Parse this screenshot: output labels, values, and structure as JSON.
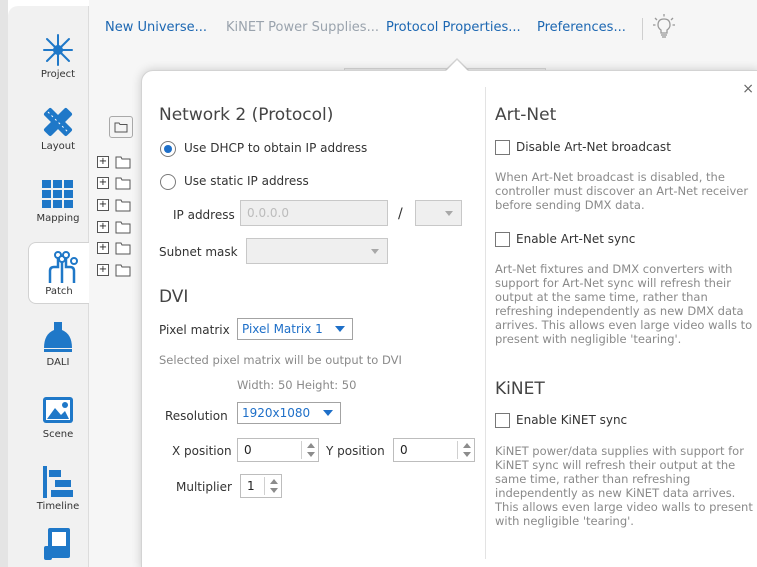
{
  "sidebar": {
    "items": [
      {
        "label": "Project",
        "icon": "project-icon"
      },
      {
        "label": "Layout",
        "icon": "layout-icon"
      },
      {
        "label": "Mapping",
        "icon": "mapping-icon"
      },
      {
        "label": "Patch",
        "icon": "patch-icon",
        "active": true
      },
      {
        "label": "DALI",
        "icon": "dali-icon"
      },
      {
        "label": "Scene",
        "icon": "scene-icon"
      },
      {
        "label": "Timeline",
        "icon": "timeline-icon"
      },
      {
        "label": "",
        "icon": "device-icon"
      }
    ]
  },
  "menu": {
    "items": [
      {
        "label": "New Universe...",
        "enabled": true
      },
      {
        "label": "KiNET Power Supplies...",
        "enabled": false
      },
      {
        "label": "Protocol Properties...",
        "enabled": true
      },
      {
        "label": "Preferences...",
        "enabled": true
      }
    ],
    "icon": "lightbulb-icon"
  },
  "dialog": {
    "close_label": "×",
    "network": {
      "title": "Network 2 (Protocol)",
      "dhcp_label": "Use DHCP to obtain IP address",
      "static_label": "Use static IP address",
      "selected": "dhcp",
      "ip_label": "IP address",
      "ip_value": "0.0.0.0",
      "ip_separator": "/",
      "subnet_label": "Subnet mask",
      "subnet_value": ""
    },
    "dvi": {
      "title": "DVI",
      "pixel_matrix_label": "Pixel matrix",
      "pixel_matrix_value": "Pixel Matrix 1",
      "note": "Selected pixel matrix will be output to DVI",
      "size_info": "Width: 50 Height: 50",
      "resolution_label": "Resolution",
      "resolution_value": "1920x1080",
      "x_label": "X position",
      "x_value": "0",
      "y_label": "Y position",
      "y_value": "0",
      "multiplier_label": "Multiplier",
      "multiplier_value": "1"
    },
    "artnet": {
      "title": "Art-Net",
      "disable_broadcast_label": "Disable Art-Net broadcast",
      "disable_broadcast_checked": false,
      "broadcast_note": "When Art-Net broadcast is disabled, the controller must discover an Art-Net receiver before sending DMX data.",
      "sync_label": "Enable Art-Net sync",
      "sync_checked": false,
      "sync_note": "Art-Net fixtures and DMX converters with support for Art-Net sync will refresh their output at the same time, rather than refreshing independently as new DMX data arrives. This allows even large video walls to present with negligible 'tearing'."
    },
    "kinet": {
      "title": "KiNET",
      "sync_label": "Enable KiNET sync",
      "sync_checked": false,
      "sync_note": "KiNET power/data supplies with support for KiNET sync will refresh their output at the same time, rather than refreshing independently as new KiNET data arrives. This allows even large video walls to present with negligible 'tearing'."
    }
  },
  "colors": {
    "accent": "#1e6fc8",
    "link": "#1c67b2",
    "icon_blue": "#1f78c8",
    "muted_text": "#8a8a8a"
  }
}
